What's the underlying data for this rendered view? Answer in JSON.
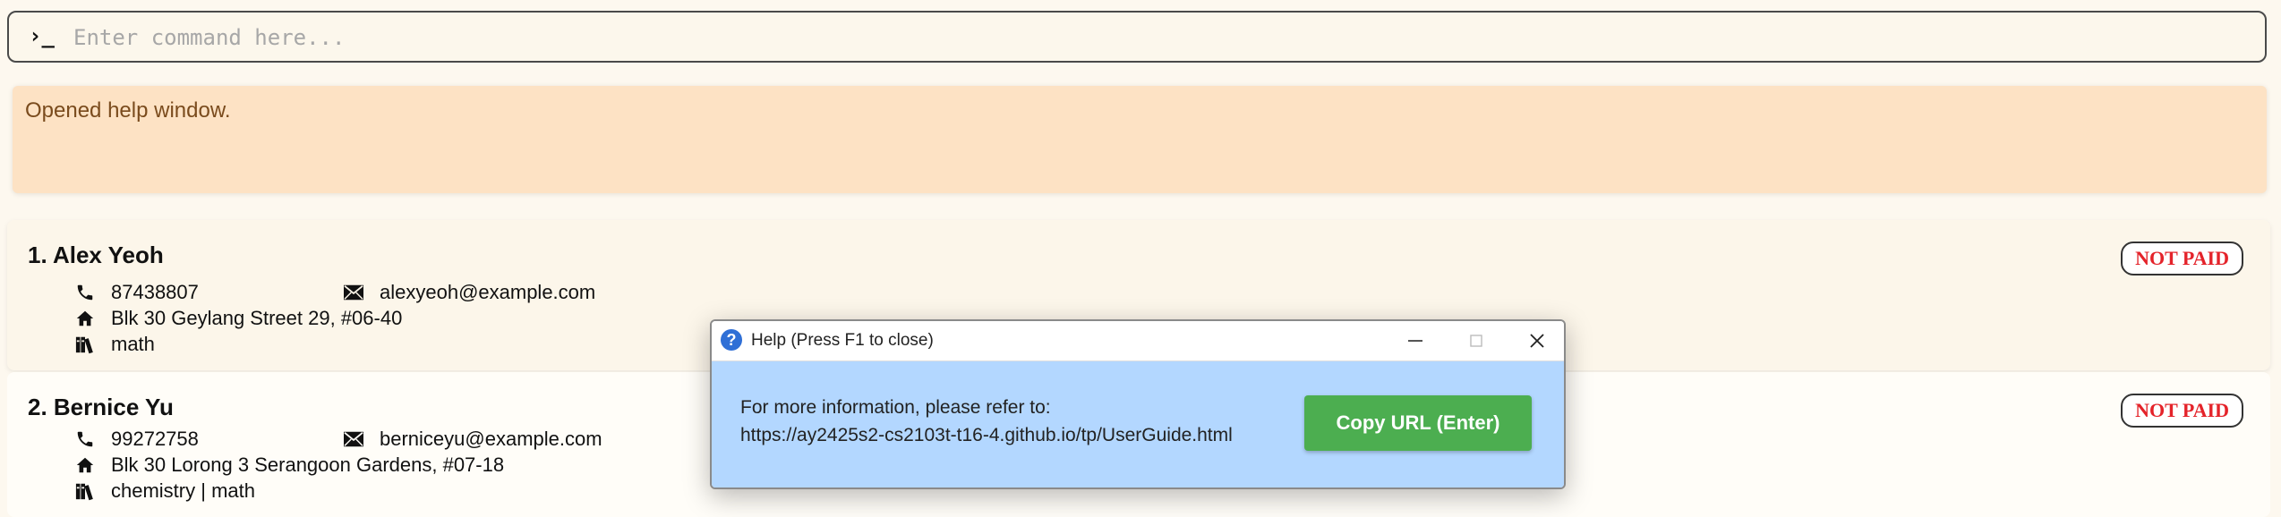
{
  "command": {
    "prompt_symbol": "›_",
    "placeholder": "Enter command here..."
  },
  "result": {
    "message": "Opened help window."
  },
  "persons": [
    {
      "index_name": "1. Alex Yeoh",
      "phone": "87438807",
      "email": "alexyeoh@example.com",
      "address": "Blk 30 Geylang Street 29, #06-40",
      "subjects": "math",
      "status": "NOT PAID"
    },
    {
      "index_name": "2. Bernice Yu",
      "phone": "99272758",
      "email": "berniceyu@example.com",
      "address": "Blk 30 Lorong 3 Serangoon Gardens, #07-18",
      "subjects": "chemistry | math",
      "status": "NOT PAID"
    }
  ],
  "help_window": {
    "title": "Help (Press F1 to close)",
    "icon": "question-icon",
    "info_line": "For more information, please refer to:",
    "url": "https://ay2425s2-cs2103t-t16-4.github.io/tp/UserGuide.html",
    "copy_button": "Copy URL (Enter)"
  },
  "colors": {
    "status_text": "#e4232a",
    "result_bg": "#fde2c4",
    "help_body_bg": "#b3d7ff",
    "copy_button_bg": "#4cae50"
  }
}
